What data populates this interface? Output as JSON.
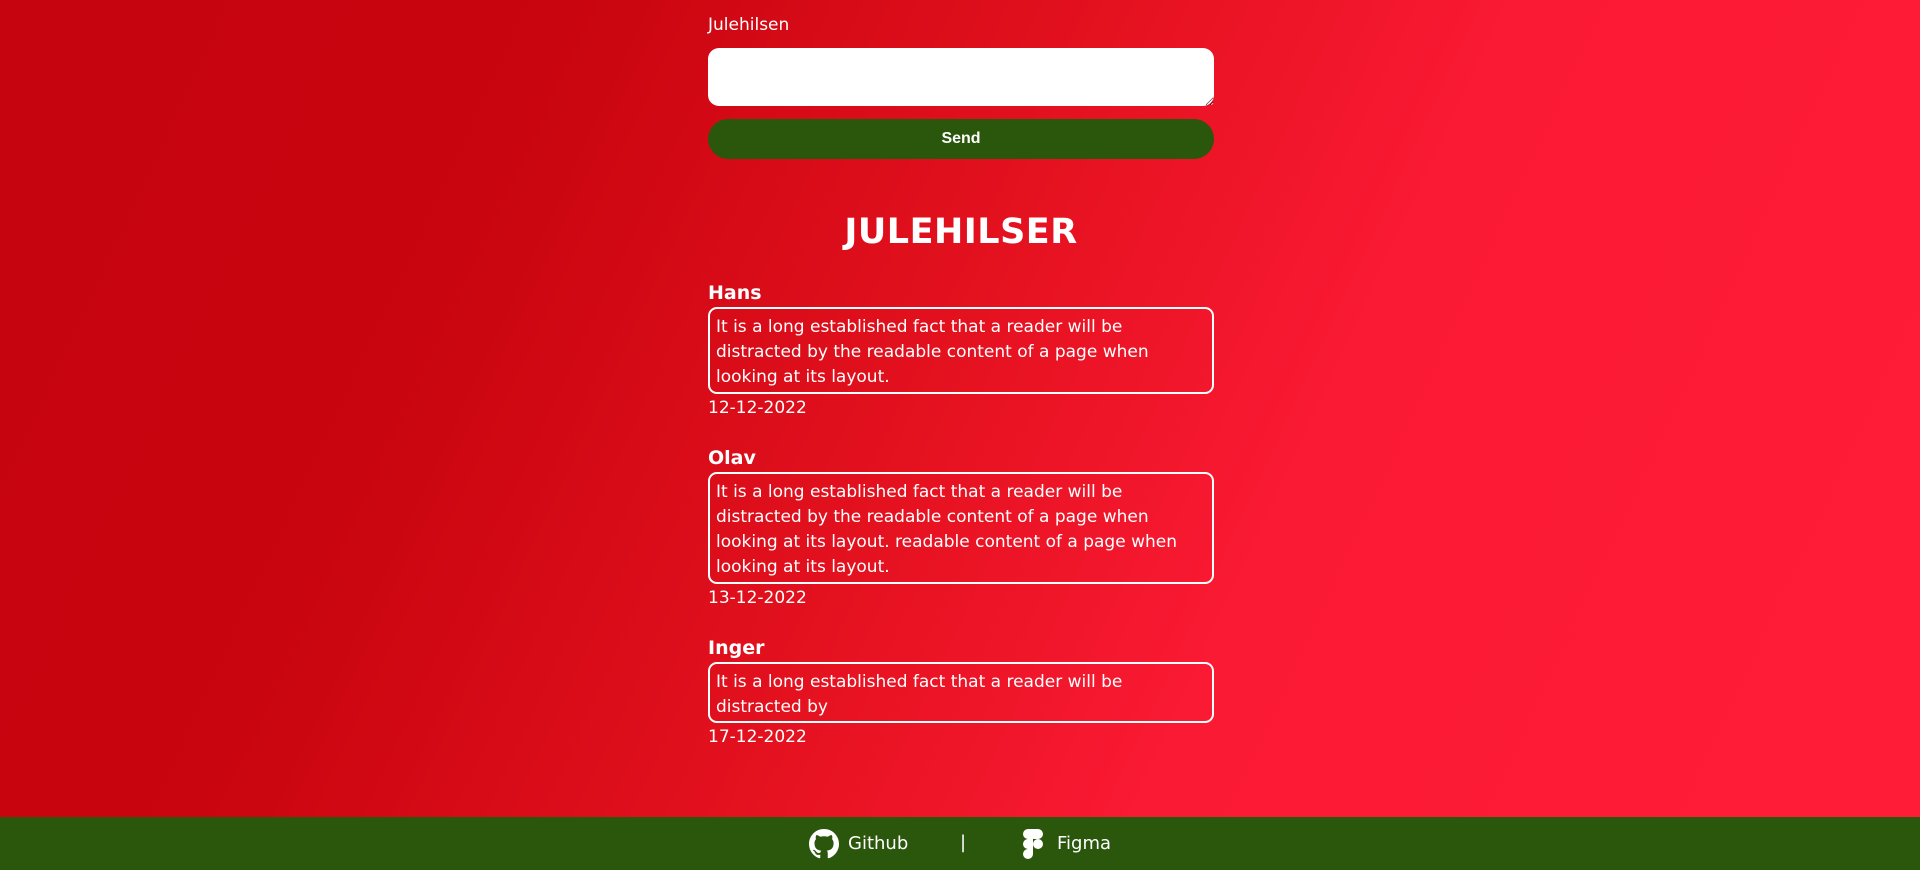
{
  "form": {
    "label": "Julehilsen",
    "message_value": "",
    "send_label": "Send"
  },
  "greetings_section": {
    "title": "JULEHILSER",
    "items": [
      {
        "name": "Hans",
        "message": "It is a long established fact that a reader will be distracted by the readable content of a page when looking at its layout.",
        "date": "12-12-2022"
      },
      {
        "name": "Olav",
        "message": "It is a long established fact that a reader will be distracted by the readable content of a page when looking at its layout. readable content of a page when looking at its layout.",
        "date": "13-12-2022"
      },
      {
        "name": "Inger",
        "message": "It is a long established fact that a reader will be distracted by",
        "date": "17-12-2022"
      }
    ]
  },
  "footer": {
    "links": [
      {
        "label": "Github",
        "icon": "github-icon"
      },
      {
        "label": "Figma",
        "icon": "figma-icon"
      }
    ],
    "separator": "|"
  },
  "colors": {
    "background_start": "#c5040f",
    "background_end": "#ff1c37",
    "accent_green": "#2a570c",
    "text": "#ffffff"
  }
}
